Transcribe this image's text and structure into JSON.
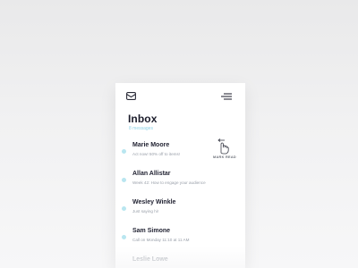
{
  "header": {
    "mail_icon": "mail-icon",
    "menu_icon": "hamburger-menu-icon",
    "title": "Inbox",
    "subtitle": "8 messages"
  },
  "colors": {
    "accent": "#8fd3e6",
    "unread_dot": "#b9e6f0",
    "title": "#1b1c2b"
  },
  "messages": [
    {
      "name": "Marie Moore",
      "preview": "Act now! 50% off to items!",
      "action_label": "MARK READ",
      "action_icon": "swipe-left-gesture-icon"
    },
    {
      "name": "Allan Allistar",
      "preview": "Week 42: How to engage your audience"
    },
    {
      "name": "Wesley Winkle",
      "preview": "Just saying hi!"
    },
    {
      "name": "Sam Simone",
      "preview": "Call on Monday 11:10 at 11 AM"
    },
    {
      "name": "Leslie Lowe",
      "preview": ""
    }
  ]
}
